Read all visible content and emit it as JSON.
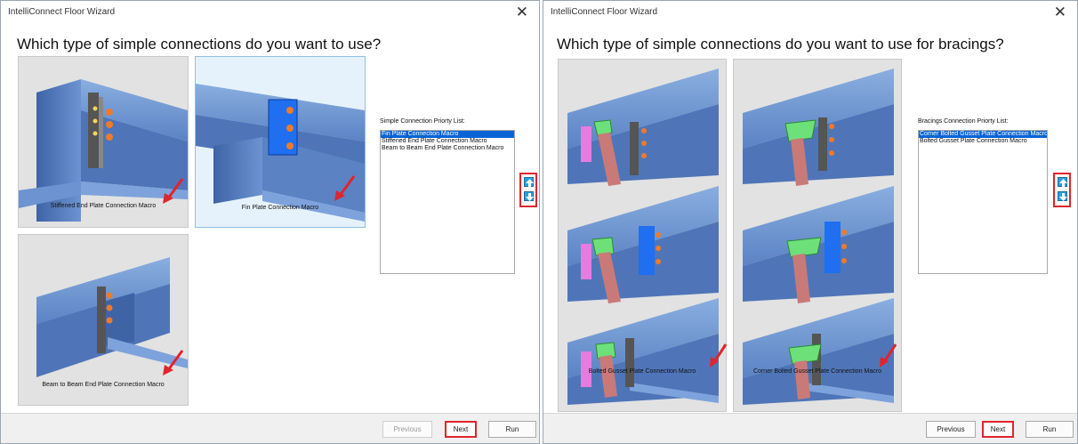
{
  "left_window": {
    "title": "IntelliConnect Floor Wizard",
    "close_glyph": "✕",
    "question": "Which type of simple connections do you want to use?",
    "tiles": [
      {
        "caption": "Stiffened End Plate Connection Macro",
        "selected": false
      },
      {
        "caption": "Fin Plate Connection Macro",
        "selected": true
      },
      {
        "caption": "Beam to Beam End Plate Connection Macro",
        "selected": false
      }
    ],
    "priority_label": "Simple Connection Priorty List:",
    "priority_items": [
      "Fin Plate Connection Macro",
      "Stiffened End Plate Connection Macro",
      "Beam to Beam End Plate Connection Macro"
    ],
    "selected_index": 0,
    "up_icon": "arrow-up-icon",
    "down_icon": "arrow-down-icon",
    "buttons": {
      "previous": "Previous",
      "next": "Next",
      "run": "Run"
    }
  },
  "right_window": {
    "title": "IntelliConnect Floor Wizard",
    "close_glyph": "✕",
    "question": "Which type of simple connections do you want to use for bracings?",
    "tiles": [
      {
        "caption": "Bolted Gusset Plate Connection Macro"
      },
      {
        "caption": "Corner Bolted Gusset Plate Connection Macro"
      }
    ],
    "priority_label": "Bracings Connection Priorty List:",
    "priority_items": [
      "Corner Bolted Gusset Plate Connection Macro",
      "Bolted Gusset Plate Connection Macro"
    ],
    "selected_index": 0,
    "up_icon": "arrow-up-icon",
    "down_icon": "arrow-down-icon",
    "buttons": {
      "previous": "Previous",
      "next": "Next",
      "run": "Run"
    }
  },
  "colors": {
    "highlight": "#e0242d",
    "steel": "#5b83c4",
    "fin_plate": "#1f6ff0",
    "gusset": "#6ee07a",
    "brace": "#c97a78",
    "magenta_plate": "#e77be0",
    "selection": "#0a64d6"
  }
}
